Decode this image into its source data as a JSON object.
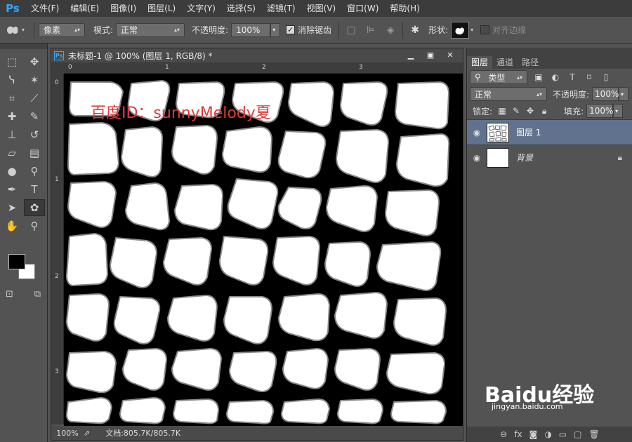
{
  "app": {
    "logo": "Ps"
  },
  "menu": [
    "文件(F)",
    "编辑(E)",
    "图像(I)",
    "图层(L)",
    "文字(Y)",
    "选择(S)",
    "滤镜(T)",
    "视图(V)",
    "窗口(W)",
    "帮助(H)"
  ],
  "options": {
    "tool_icon": "custom-shape-icon",
    "fill_mode": "像素",
    "mode_label": "模式:",
    "mode_value": "正常",
    "opacity_label": "不透明度:",
    "opacity_value": "100%",
    "antialias_label": "消除锯齿",
    "shape_label": "形状:",
    "align_edges_label": "对齐边缘"
  },
  "document": {
    "title": "未标题-1 @ 100% (图层 1, RGB/8) *",
    "ruler_marks": [
      "0",
      "1",
      "2",
      "3"
    ],
    "zoom": "100%",
    "status": "文档:805.7K/805.7K",
    "watermark": "百度ID：sunnyMelody夏"
  },
  "layers_panel": {
    "tabs": [
      "图层",
      "通道",
      "路径"
    ],
    "filter_label": "类型",
    "blend_mode": "正常",
    "opacity_label": "不透明度:",
    "opacity_value": "100%",
    "lock_label": "锁定:",
    "fill_label": "填充:",
    "fill_value": "100%",
    "layers": [
      {
        "name": "图层 1",
        "selected": true
      },
      {
        "name": "背景",
        "locked": true
      }
    ]
  },
  "baidu_brand": {
    "name": "Baidu经验",
    "url": "jingyan.baidu.com"
  }
}
